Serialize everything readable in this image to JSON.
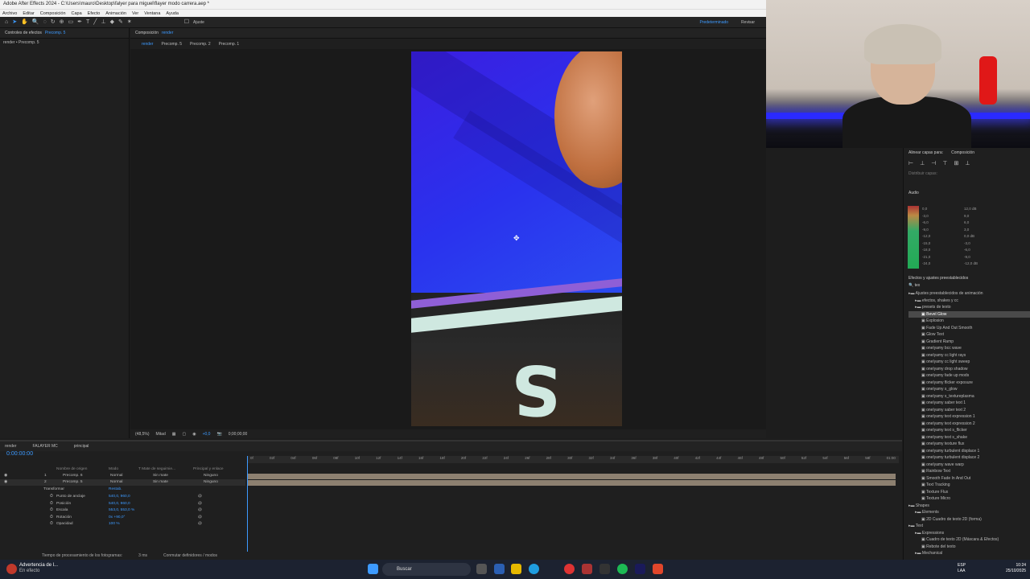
{
  "window": {
    "title": "Adobe After Effects 2024 - C:\\Users\\mauro\\Desktop\\falyer para miguel\\flayer modo carrera.aep *"
  },
  "menu": [
    "Archivo",
    "Editar",
    "Composición",
    "Capa",
    "Efecto",
    "Animación",
    "Ver",
    "Ventana",
    "Ayuda"
  ],
  "toolbar": {
    "snap_label": "Ajuste",
    "workspace_default": "Predeterminado",
    "workspace_review": "Revisar"
  },
  "effects_panel": {
    "title": "Controles de efectos",
    "layer": "Precomp. 5",
    "subtitle": "render • Precomp. 5"
  },
  "comp_panel": {
    "title": "Composición",
    "comp": "render",
    "tabs": [
      "render",
      "Precomp. 5",
      "Precomp. 2",
      "Precomp. 1"
    ]
  },
  "viewer_bar": {
    "zoom": "(48,5%)",
    "resolution": "Mitad",
    "exposure": "+0,0",
    "time": "0;00;00;00"
  },
  "align": {
    "title": "Alinear capas para:",
    "target": "Composición",
    "distribute": "Distribuir capas:"
  },
  "audio": {
    "title": "Audio",
    "left_scale": [
      "0,0",
      "-3,0",
      "-6,0",
      "-9,0",
      "-12,0",
      "-15,0",
      "-18,0",
      "-21,0",
      "-24,0"
    ],
    "right_scale": [
      "12,0 dB",
      "9,0",
      "6,0",
      "3,0",
      "0,0 dB",
      "-3,0",
      "-6,0",
      "-9,0",
      "-12,0 dB"
    ]
  },
  "effects_presets": {
    "title": "Efectos y ajustes preestablecidos",
    "search": "tex",
    "items": [
      {
        "label": "Ajustes preestablecidos de animación",
        "level": 0,
        "type": "folder"
      },
      {
        "label": "efectos, shakes y cc",
        "level": 1,
        "type": "folder"
      },
      {
        "label": "presets de texto",
        "level": 1,
        "type": "folder"
      },
      {
        "label": "Bevel Glow",
        "level": 2,
        "type": "preset",
        "selected": true
      },
      {
        "label": "Explosion",
        "level": 2,
        "type": "preset"
      },
      {
        "label": "Fade Up And Out Smooth",
        "level": 2,
        "type": "preset"
      },
      {
        "label": "Glow Text",
        "level": 2,
        "type": "preset"
      },
      {
        "label": "Gradient Ramp",
        "level": 2,
        "type": "preset"
      },
      {
        "label": "onelyamy bcc wave",
        "level": 2,
        "type": "preset"
      },
      {
        "label": "onelyamy cc light rays",
        "level": 2,
        "type": "preset"
      },
      {
        "label": "onelyamy cc light sweep",
        "level": 2,
        "type": "preset"
      },
      {
        "label": "onelyamy drop shadow",
        "level": 2,
        "type": "preset"
      },
      {
        "label": "onelyamy fade up mods",
        "level": 2,
        "type": "preset"
      },
      {
        "label": "onelyamy flicker exposure",
        "level": 2,
        "type": "preset"
      },
      {
        "label": "onelyamy s_glow",
        "level": 2,
        "type": "preset"
      },
      {
        "label": "onelyamy s_textureplasma",
        "level": 2,
        "type": "preset"
      },
      {
        "label": "onelyamy saber text 1",
        "level": 2,
        "type": "preset"
      },
      {
        "label": "onelyamy saber text 2",
        "level": 2,
        "type": "preset"
      },
      {
        "label": "onelyamy text expression 1",
        "level": 2,
        "type": "preset"
      },
      {
        "label": "onelyamy text expression 2",
        "level": 2,
        "type": "preset"
      },
      {
        "label": "onelyamy text s_flicker",
        "level": 2,
        "type": "preset"
      },
      {
        "label": "onelyamy text s_shake",
        "level": 2,
        "type": "preset"
      },
      {
        "label": "onelyamy texture flux",
        "level": 2,
        "type": "preset"
      },
      {
        "label": "onelyamy turbulent displace 1",
        "level": 2,
        "type": "preset"
      },
      {
        "label": "onelyamy turbulent displace 2",
        "level": 2,
        "type": "preset"
      },
      {
        "label": "onelyamy wave warp",
        "level": 2,
        "type": "preset"
      },
      {
        "label": "Rainbow Text",
        "level": 2,
        "type": "preset"
      },
      {
        "label": "Smooth Fade In And Out",
        "level": 2,
        "type": "preset"
      },
      {
        "label": "Text Tracking",
        "level": 2,
        "type": "preset"
      },
      {
        "label": "Texture Flux",
        "level": 2,
        "type": "preset"
      },
      {
        "label": "Texture Micro",
        "level": 2,
        "type": "preset"
      },
      {
        "label": "Shapes",
        "level": 0,
        "type": "folder"
      },
      {
        "label": "Elements",
        "level": 1,
        "type": "folder"
      },
      {
        "label": "2D Cuadro de texto 2D (forma)",
        "level": 2,
        "type": "preset"
      },
      {
        "label": "Text",
        "level": 0,
        "type": "folder"
      },
      {
        "label": "Expressions",
        "level": 1,
        "type": "folder"
      },
      {
        "label": "Cuadro de texto 2D (Máscara & Efectos)",
        "level": 2,
        "type": "preset"
      },
      {
        "label": "Rebote del texto",
        "level": 2,
        "type": "preset"
      },
      {
        "label": "Mechanical",
        "level": 1,
        "type": "folder"
      }
    ]
  },
  "timeline": {
    "tabs": [
      "render",
      "FALAYER MC",
      "principal"
    ],
    "time": "0:00:00:00",
    "headers": {
      "name": "Nombre de origen",
      "mode": "Modo",
      "track": "T  Mate de seguimie...",
      "parent": "Principal y enlace"
    },
    "ruler": [
      "0f",
      "02f",
      "04f",
      "06f",
      "08f",
      "10f",
      "12f",
      "14f",
      "16f",
      "18f",
      "20f",
      "22f",
      "24f",
      "26f",
      "28f",
      "30f",
      "32f",
      "34f",
      "36f",
      "38f",
      "40f",
      "42f",
      "44f",
      "46f",
      "48f",
      "50f",
      "52f",
      "54f",
      "56f",
      "58f",
      "01:00"
    ],
    "layers": [
      {
        "num": "1",
        "name": "Precomp. 6",
        "mode": "Normal",
        "matte": "Sin mate",
        "parent": "Ninguno"
      },
      {
        "num": "2",
        "name": "Precomp. 5",
        "mode": "Normal",
        "matte": "Sin mate",
        "parent": "Ninguno"
      }
    ],
    "transform": {
      "title": "Transformar",
      "reset": "Restab.",
      "props": [
        {
          "label": "Punto de anclaje",
          "value": "540,0, 960,0"
        },
        {
          "label": "Posición",
          "value": "540,0, 960,0"
        },
        {
          "label": "Escala",
          "value": "553,0, 553,0 %"
        },
        {
          "label": "Rotación",
          "value": "0x +90,0°"
        },
        {
          "label": "Opacidad",
          "value": "100 %"
        }
      ]
    }
  },
  "status": {
    "render_time": "Tiempo de procesamiento de los fotogramas:",
    "render_value": "3 ms",
    "toggle": "Conmutar definidores / modos"
  },
  "taskbar": {
    "warning_title": "Advertencia de l...",
    "warning_sub": "En efecto",
    "search": "Buscar",
    "lang1": "ESP",
    "lang2": "LAA",
    "time": "10:24",
    "date": "25/10/2025"
  },
  "colors": {
    "accent": "#3d9aff",
    "track": "#8d8070"
  }
}
